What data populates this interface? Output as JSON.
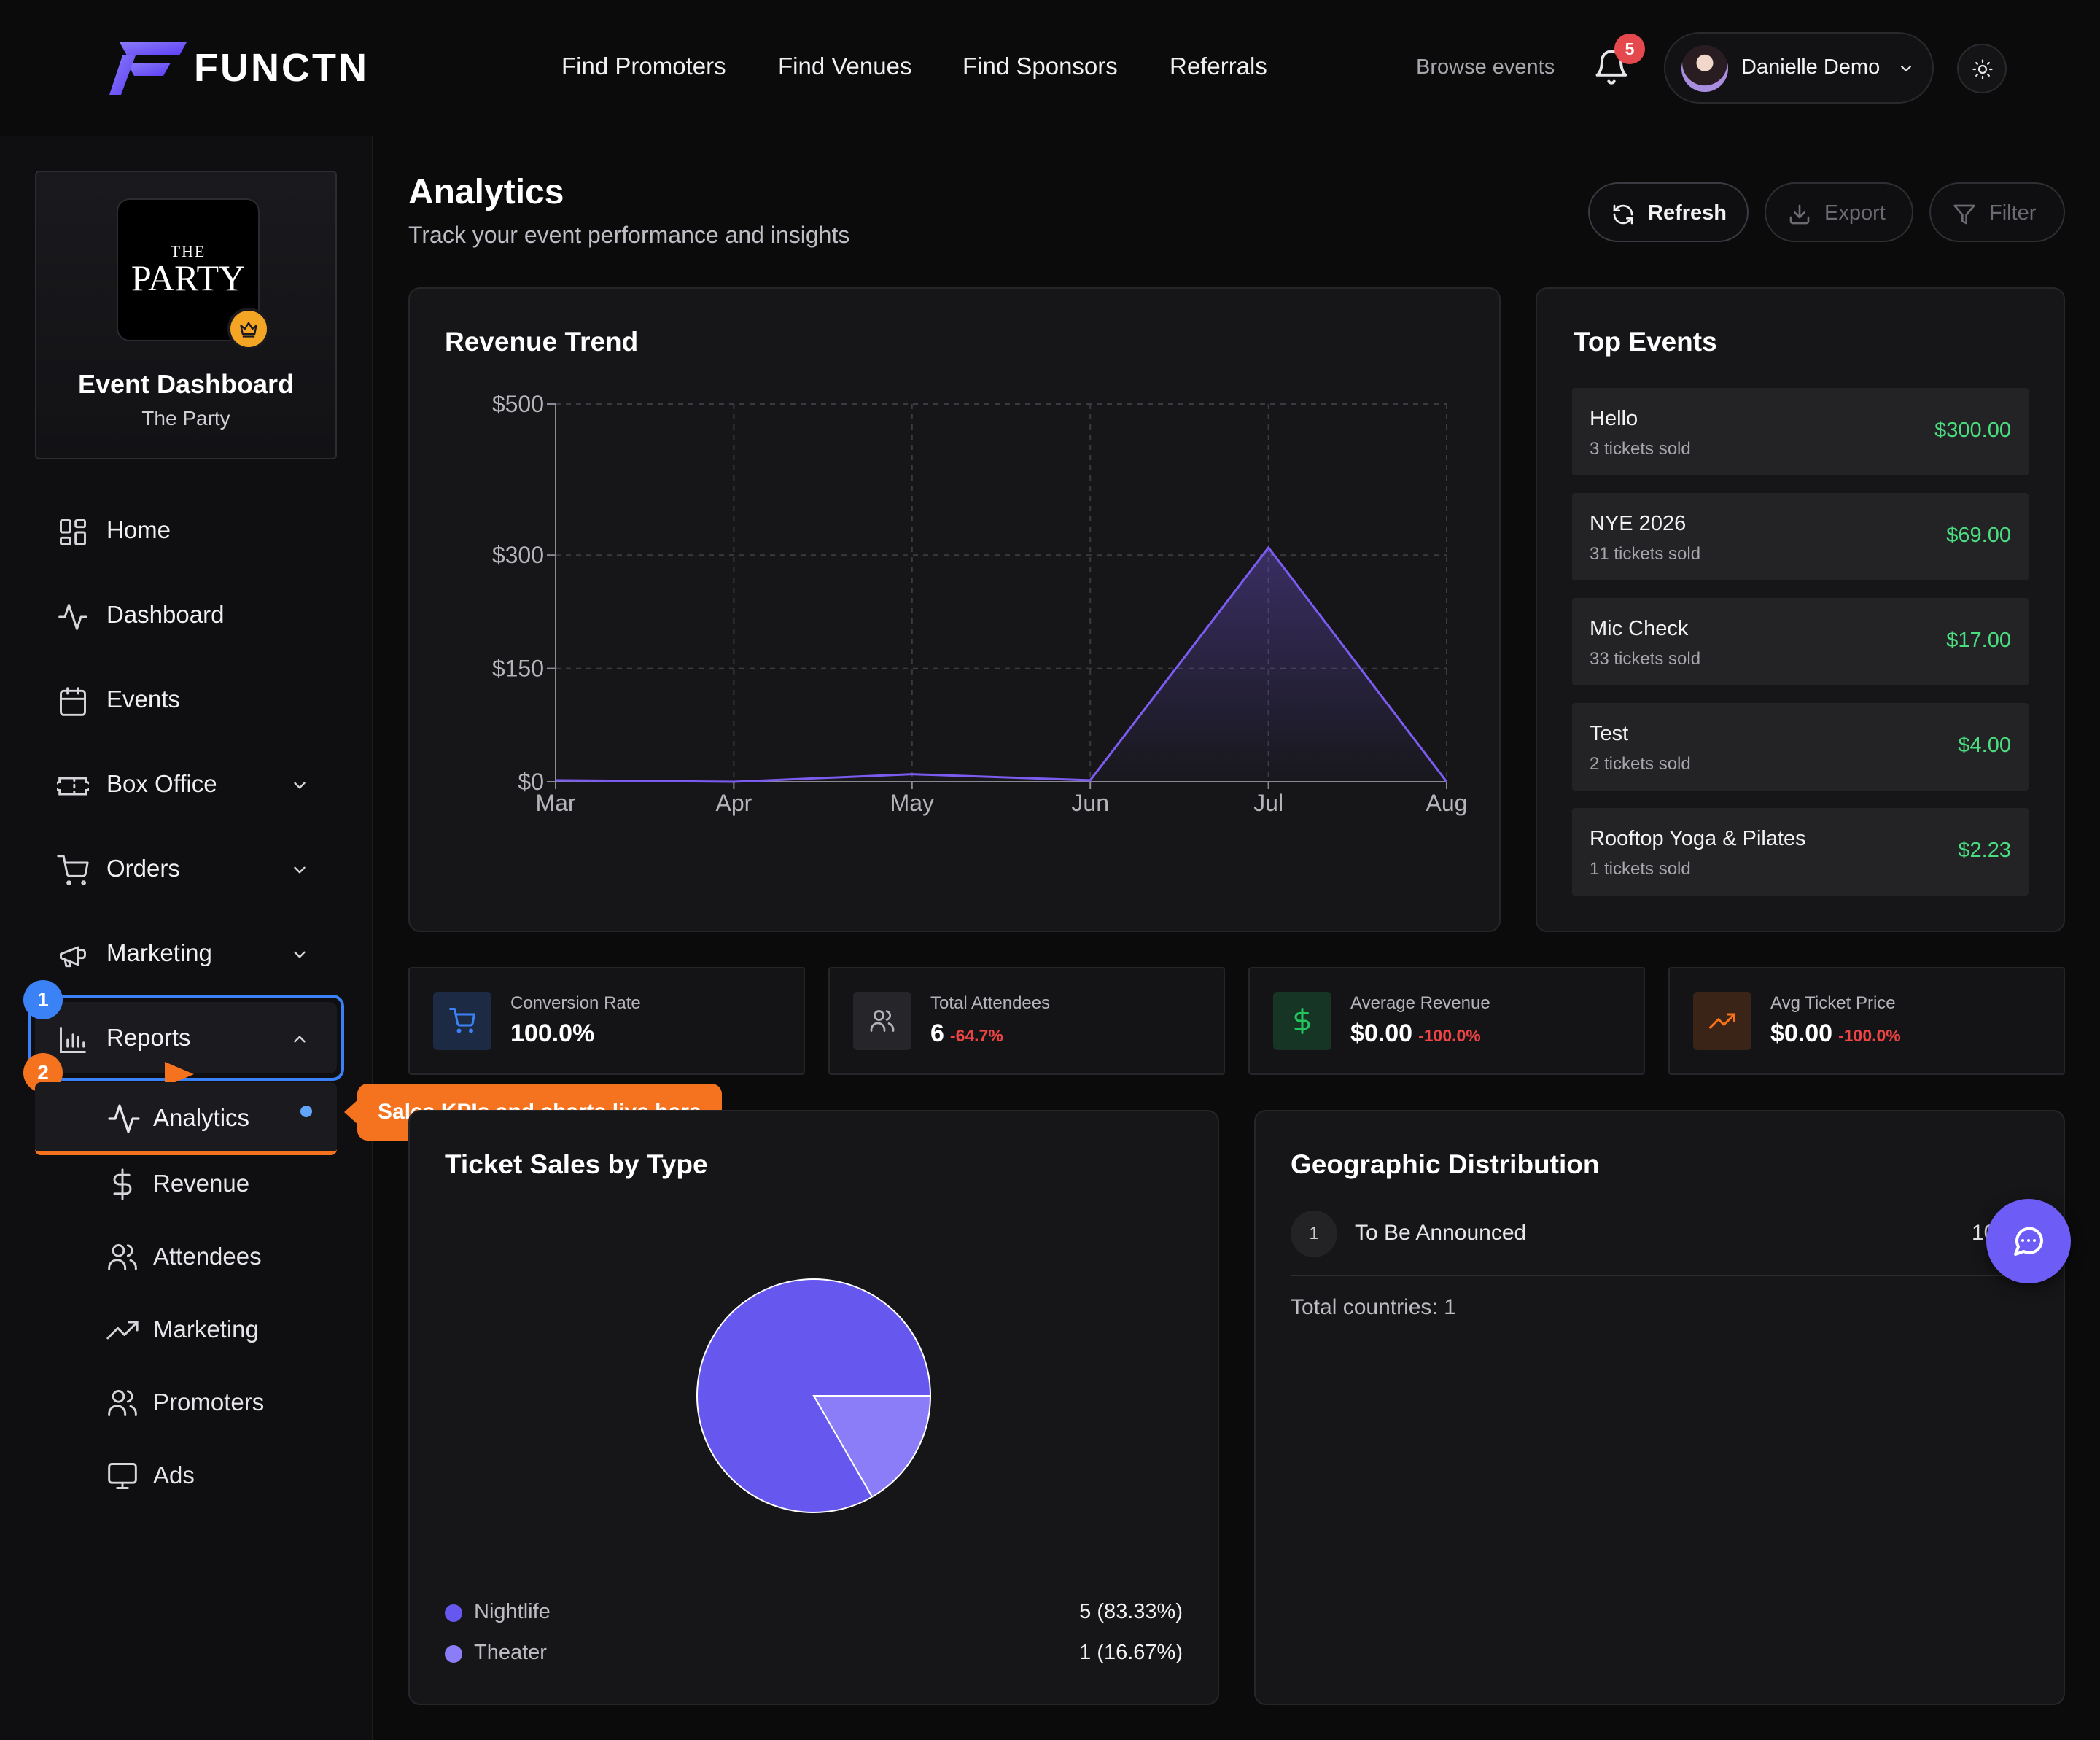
{
  "brand": {
    "name": "FUNCTN",
    "accent": "#6d5cf6"
  },
  "topnav": [
    "Find Promoters",
    "Find Venues",
    "Find Sponsors",
    "Referrals"
  ],
  "header": {
    "browse": "Browse events",
    "notifications": "5",
    "user_name": "Danielle Demo"
  },
  "profile": {
    "logo_small": "THE",
    "logo_big": "PARTY",
    "title": "Event Dashboard",
    "subtitle": "The Party"
  },
  "sidebar": {
    "items": [
      {
        "label": "Home",
        "icon": "grid-icon"
      },
      {
        "label": "Dashboard",
        "icon": "activity-icon"
      },
      {
        "label": "Events",
        "icon": "calendar-icon"
      },
      {
        "label": "Box Office",
        "icon": "ticket-icon"
      },
      {
        "label": "Orders",
        "icon": "cart-icon"
      },
      {
        "label": "Marketing",
        "icon": "megaphone-icon"
      },
      {
        "label": "Reports",
        "icon": "bar-chart-icon"
      }
    ],
    "reports_sub": [
      {
        "label": "Analytics",
        "icon": "activity-icon"
      },
      {
        "label": "Revenue",
        "icon": "dollar-icon"
      },
      {
        "label": "Attendees",
        "icon": "users-icon"
      },
      {
        "label": "Marketing",
        "icon": "trending-up-icon"
      },
      {
        "label": "Promoters",
        "icon": "users-icon"
      },
      {
        "label": "Ads",
        "icon": "monitor-icon"
      }
    ],
    "step1": "1",
    "step2": "2",
    "tooltip": "Sales KPIs and charts live here"
  },
  "page": {
    "title": "Analytics",
    "subtitle": "Track your event performance and insights"
  },
  "actions": {
    "refresh": "Refresh",
    "export": "Export",
    "filter": "Filter"
  },
  "revenue_card": {
    "title": "Revenue Trend"
  },
  "chart_data": {
    "type": "area",
    "title": "Revenue Trend",
    "x": [
      "Mar",
      "Apr",
      "May",
      "Jun",
      "Jul",
      "Aug"
    ],
    "values": [
      2,
      0,
      10,
      2,
      310,
      0
    ],
    "y_ticks": [
      "$500",
      "$300",
      "$150",
      "$0"
    ],
    "y_tick_values": [
      500,
      300,
      150,
      0
    ],
    "ylim": [
      0,
      500
    ],
    "grid": true,
    "color": "#7c5cf0"
  },
  "top_events": {
    "title": "Top Events",
    "items": [
      {
        "name": "Hello",
        "sub": "3 tickets sold",
        "amount": "$300.00"
      },
      {
        "name": "NYE 2026",
        "sub": "31 tickets sold",
        "amount": "$69.00"
      },
      {
        "name": "Mic Check",
        "sub": "33 tickets sold",
        "amount": "$17.00"
      },
      {
        "name": "Test",
        "sub": "2 tickets sold",
        "amount": "$4.00"
      },
      {
        "name": "Rooftop Yoga & Pilates",
        "sub": "1 tickets sold",
        "amount": "$2.23"
      }
    ]
  },
  "kpis": [
    {
      "label": "Conversion Rate",
      "value": "100.0%",
      "change": "",
      "icon": "cart-icon",
      "color": "#3b82f6"
    },
    {
      "label": "Total Attendees",
      "value": "6",
      "change": "-64.7%",
      "icon": "users-icon",
      "color": "#9ca3af"
    },
    {
      "label": "Average Revenue",
      "value": "$0.00",
      "change": "-100.0%",
      "icon": "dollar-icon",
      "color": "#22c55e"
    },
    {
      "label": "Avg Ticket Price",
      "value": "$0.00",
      "change": "-100.0%",
      "icon": "trending-up-icon",
      "color": "#f97316"
    }
  ],
  "ticket_sales": {
    "title": "Ticket Sales by Type",
    "chart_data": {
      "type": "pie",
      "categories": [
        "Nightlife",
        "Theater"
      ],
      "values": [
        5,
        1
      ],
      "labels": [
        "5 (83.33%)",
        "1 (16.67%)"
      ],
      "colors": [
        "#6658ee",
        "#8b7cf8"
      ]
    }
  },
  "geo": {
    "title": "Geographic Distribution",
    "rows": [
      {
        "rank": "1",
        "name": "To Be Announced",
        "value": "10"
      }
    ],
    "total": "Total countries: 1"
  }
}
